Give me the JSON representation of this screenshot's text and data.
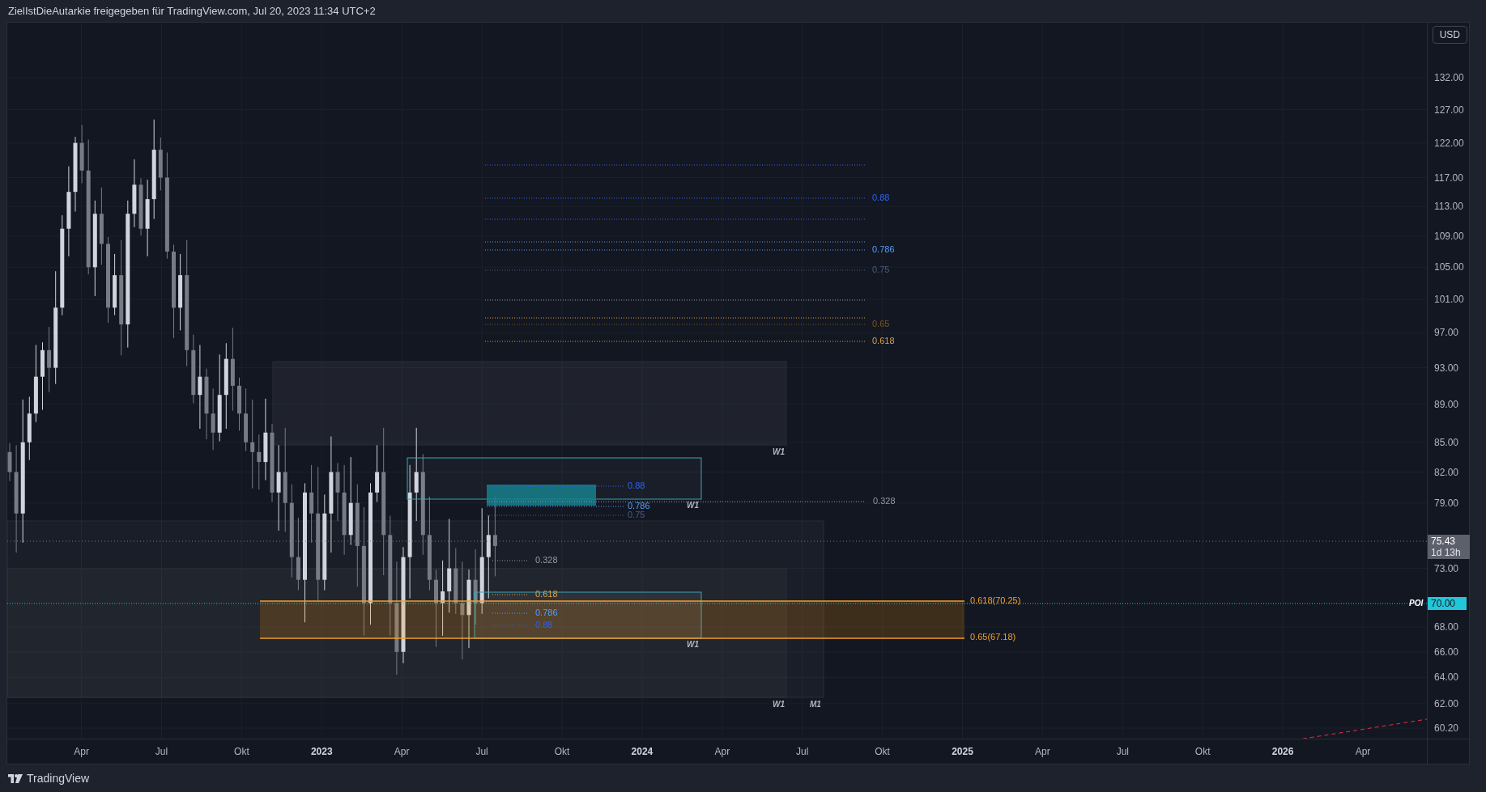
{
  "header": {
    "title": "ZielIstDieAutarkie freigegeben für TradingView.com, Jul 20, 2023 11:34 UTC+2"
  },
  "price_axis": {
    "currency_button": "USD",
    "ticks": [
      "132.00",
      "127.00",
      "122.00",
      "117.00",
      "113.00",
      "109.00",
      "105.00",
      "101.00",
      "97.00",
      "93.00",
      "89.00",
      "85.00",
      "82.00",
      "79.00",
      "73.00",
      "68.00",
      "66.00",
      "64.00",
      "62.00",
      "60.20"
    ],
    "last_price": {
      "value": "75.43",
      "countdown": "1d 13h"
    },
    "poi_price": "70.00"
  },
  "chart": {
    "upper_fib": [
      {
        "label": "0.88",
        "color": "#2f62f0"
      },
      {
        "label": "0.786",
        "color": "#5b9cf6"
      },
      {
        "label": "0.75",
        "color": "#4c5d80"
      },
      {
        "label": "0.65",
        "color": "#7a5420"
      },
      {
        "label": "0.618",
        "color": "#e0a040"
      }
    ],
    "zone_tags": [
      "W1",
      "W1",
      "W1",
      "W1",
      "M1"
    ],
    "mid_fib": [
      {
        "label": "0.88",
        "color": "#2f62f0"
      },
      {
        "label": "0.786",
        "color": "#5b9cf6"
      },
      {
        "label": "0.75",
        "color": "#4c5d80"
      },
      {
        "label": "0.328",
        "color": "#9598a1"
      }
    ],
    "lower_fib": [
      {
        "label": "0.328",
        "color": "#9598a1"
      },
      {
        "label": "0.618",
        "color": "#e0a040"
      },
      {
        "label": "0.786",
        "color": "#5b9cf6"
      },
      {
        "label": "0.88",
        "color": "#2f62f0"
      }
    ],
    "poi_levels": [
      "0.618(70.25)",
      "0.65(67.18)"
    ],
    "poi_tag": "POI"
  },
  "time_axis": {
    "ticks": [
      {
        "label": "Apr",
        "kind": "month"
      },
      {
        "label": "Jul",
        "kind": "month"
      },
      {
        "label": "Okt",
        "kind": "month"
      },
      {
        "label": "2023",
        "kind": "year"
      },
      {
        "label": "Apr",
        "kind": "month"
      },
      {
        "label": "Jul",
        "kind": "month"
      },
      {
        "label": "Okt",
        "kind": "month"
      },
      {
        "label": "2024",
        "kind": "year"
      },
      {
        "label": "Apr",
        "kind": "month"
      },
      {
        "label": "Jul",
        "kind": "month"
      },
      {
        "label": "Okt",
        "kind": "month"
      },
      {
        "label": "2025",
        "kind": "year"
      },
      {
        "label": "Apr",
        "kind": "month"
      },
      {
        "label": "Jul",
        "kind": "month"
      },
      {
        "label": "Okt",
        "kind": "month"
      },
      {
        "label": "2026",
        "kind": "year"
      },
      {
        "label": "Apr",
        "kind": "month"
      }
    ]
  },
  "footer": {
    "brand": "TradingView"
  }
}
